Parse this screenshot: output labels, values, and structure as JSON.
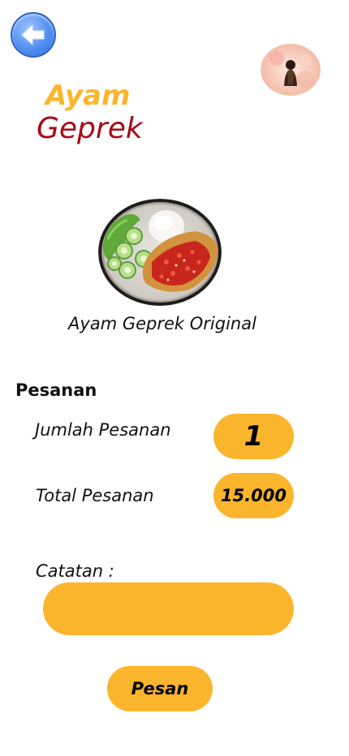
{
  "header": {
    "back_icon": "arrow-left-icon",
    "avatar_icon": "user-avatar-icon"
  },
  "title": {
    "line1": "Ayam",
    "line2": "Geprek"
  },
  "dish": {
    "image_icon": "fried-chicken-plate-image",
    "name": "Ayam Geprek Original"
  },
  "order": {
    "section_title": "Pesanan",
    "quantity_label": "Jumlah Pesanan",
    "quantity_value": "1",
    "total_label": "Total Pesanan",
    "total_value": "15.000",
    "note_label": "Catatan :",
    "note_value": "",
    "submit_label": "Pesan"
  },
  "colors": {
    "accent": "#fbb52c",
    "title_red": "#a80a14",
    "back_button": "#4f8ff0"
  }
}
